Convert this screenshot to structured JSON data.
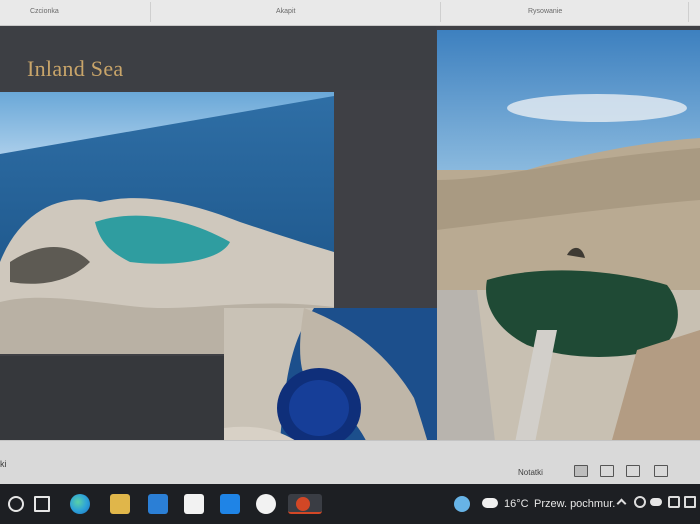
{
  "ribbon": {
    "groups": [
      "Czcionka",
      "Akapit",
      "Rysowanie"
    ]
  },
  "slide": {
    "title": "Inland Sea"
  },
  "statusbar": {
    "left_text": "ki",
    "notes_label": "Notatki"
  },
  "taskbar": {
    "weather_temp": "16°C",
    "weather_desc": "Przew. pochmur."
  },
  "colors": {
    "title_gold": "#c9a56a",
    "slide_bg": "#3f4045",
    "taskbar": "#1d1f23"
  }
}
